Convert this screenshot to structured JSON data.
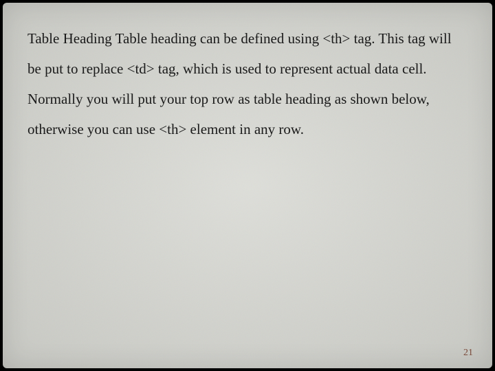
{
  "slide": {
    "body_text": "Table Heading Table heading can be defined using <th> tag. This tag will be put to replace <td> tag, which is used to represent actual data cell. Normally you will put your top row as table heading as shown below, otherwise you can use <th> element in any row.",
    "page_number": "21"
  }
}
